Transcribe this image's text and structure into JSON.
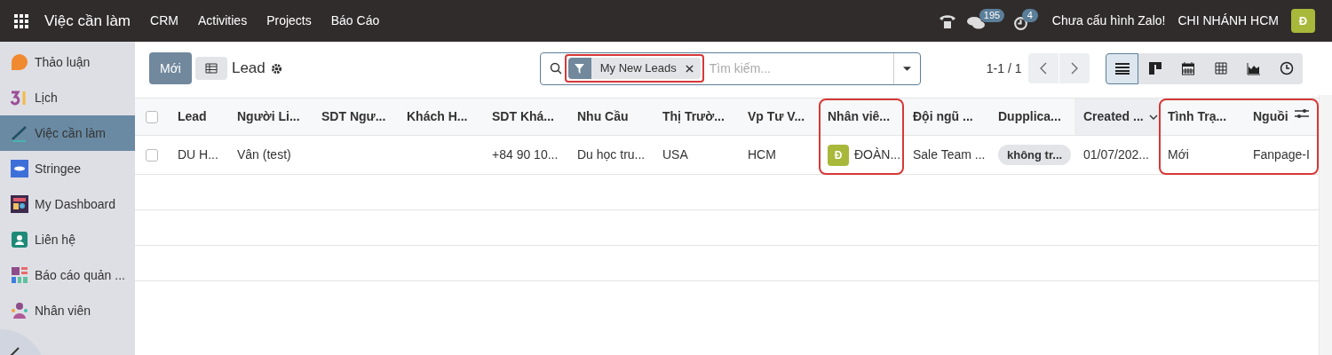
{
  "topbar": {
    "app_title": "Việc cần làm",
    "menu": [
      "CRM",
      "Activities",
      "Projects",
      "Báo Cáo"
    ],
    "messages_count": "195",
    "activities_count": "4",
    "zalo_status": "Chưa cấu hình Zalo!",
    "company": "CHI NHÁNH HCM",
    "avatar_letter": "Đ"
  },
  "sidebar": {
    "items": [
      {
        "label": "Thảo luận",
        "selected": false
      },
      {
        "label": "Lịch",
        "selected": false
      },
      {
        "label": "Việc cần làm",
        "selected": true
      },
      {
        "label": "Stringee",
        "selected": false
      },
      {
        "label": "My Dashboard",
        "selected": false
      },
      {
        "label": "Liên hệ",
        "selected": false
      },
      {
        "label": "Báo cáo quản ...",
        "selected": false
      },
      {
        "label": "Nhân viên",
        "selected": false
      }
    ]
  },
  "control_panel": {
    "new_button": "Mới",
    "breadcrumb": "Lead",
    "search": {
      "facet": {
        "label": "My New Leads",
        "highlighted": true
      },
      "placeholder": "Tìm kiếm..."
    },
    "pager": "1-1 / 1",
    "views": [
      {
        "selected": true
      },
      {
        "selected": false
      },
      {
        "selected": false
      },
      {
        "selected": false
      },
      {
        "selected": false
      },
      {
        "selected": false
      }
    ]
  },
  "table": {
    "select_all_checked": false,
    "columns": [
      {
        "label": "Lead",
        "highlighted": false,
        "sorted": false
      },
      {
        "label": "Người Li...",
        "highlighted": false,
        "sorted": false
      },
      {
        "label": "SDT Ngư...",
        "highlighted": false,
        "sorted": false
      },
      {
        "label": "Khách H...",
        "highlighted": false,
        "sorted": false
      },
      {
        "label": "SDT Khá...",
        "highlighted": false,
        "sorted": false
      },
      {
        "label": "Nhu Cầu",
        "highlighted": false,
        "sorted": false
      },
      {
        "label": "Thị Trườ...",
        "highlighted": false,
        "sorted": false
      },
      {
        "label": "Vp Tư V...",
        "highlighted": false,
        "sorted": false
      },
      {
        "label": "Nhân viê...",
        "highlighted": true,
        "sorted": false
      },
      {
        "label": "Đội ngũ ...",
        "highlighted": false,
        "sorted": false
      },
      {
        "label": "Dupplica...",
        "highlighted": false,
        "sorted": false
      },
      {
        "label": "Created ...",
        "highlighted": false,
        "sorted": true
      },
      {
        "label": "Tình Trạ...",
        "highlighted": true,
        "sorted": false
      },
      {
        "label": "Nguồi",
        "highlighted": true,
        "sorted": false
      }
    ],
    "rows": [
      {
        "checked": false,
        "cells": [
          {
            "kind": "text",
            "text": "DU H..."
          },
          {
            "kind": "text",
            "text": "Vân (test)"
          },
          {
            "kind": "empty"
          },
          {
            "kind": "empty"
          },
          {
            "kind": "text",
            "text": "+84 90 10..."
          },
          {
            "kind": "text",
            "text": "Du học tru..."
          },
          {
            "kind": "text",
            "text": "USA"
          },
          {
            "kind": "text",
            "text": "HCM"
          },
          {
            "kind": "avatar",
            "initial": "Đ",
            "text": "ĐOÀN..."
          },
          {
            "kind": "text",
            "text": "Sale Team ..."
          },
          {
            "kind": "tag",
            "text": "không tr..."
          },
          {
            "kind": "text",
            "text": "01/07/202..."
          },
          {
            "kind": "text",
            "text": "Mới"
          },
          {
            "kind": "text",
            "text": "Fanpage-I"
          }
        ]
      }
    ]
  }
}
